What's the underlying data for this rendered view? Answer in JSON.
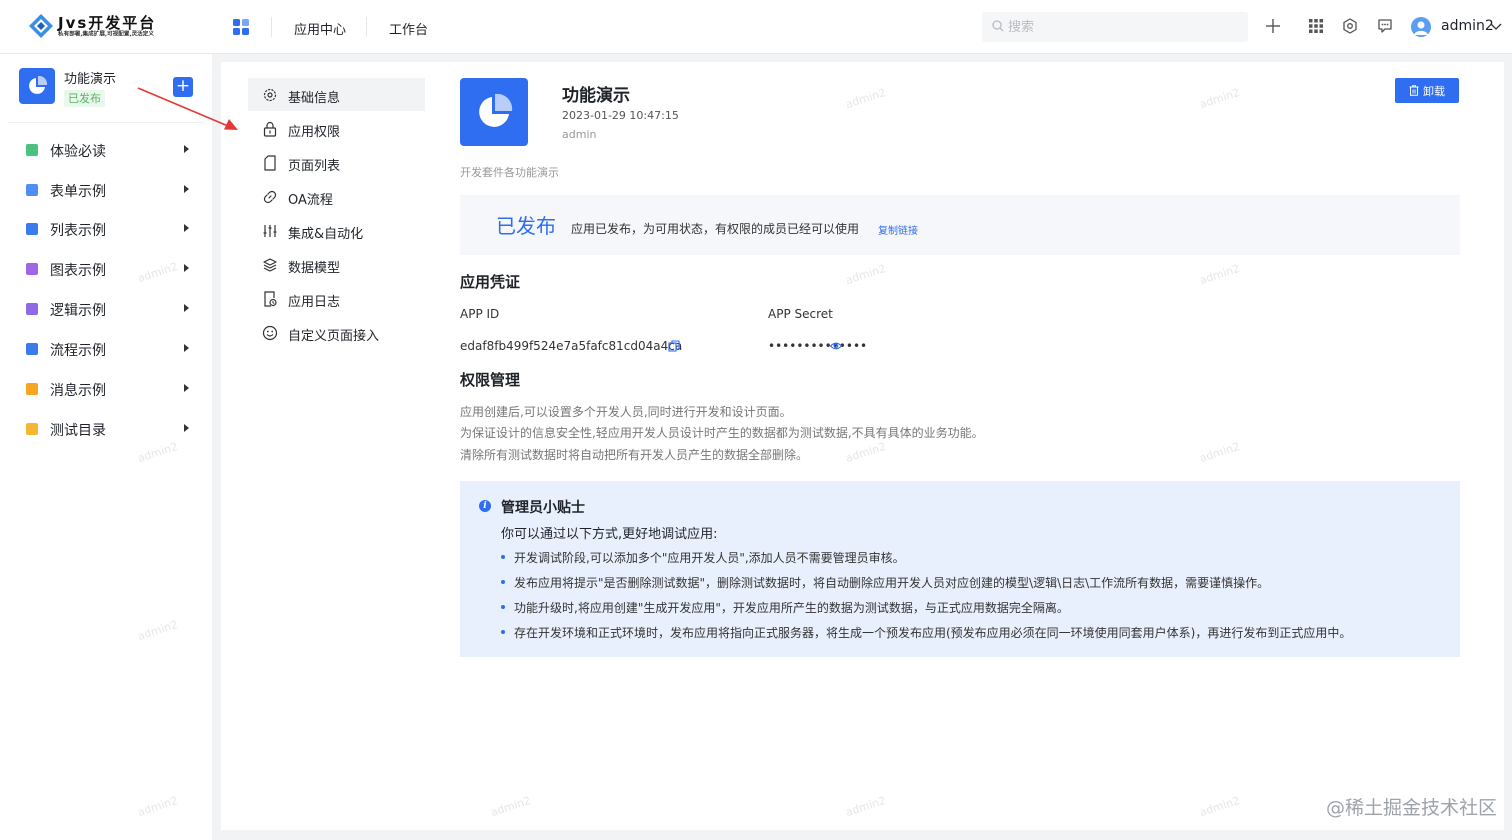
{
  "header": {
    "logo_title": "Jvs开发平台",
    "logo_subtitle": "私有部署,集成扩展,可视配置,灵活定义",
    "nav": [
      "应用中心",
      "工作台"
    ],
    "search_placeholder": "搜索",
    "user_name": "admin2"
  },
  "sidebar": {
    "app_name": "功能演示",
    "app_status": "已发布",
    "add_label": "+",
    "items": [
      {
        "label": "体验必读",
        "color": "#4bc27d"
      },
      {
        "label": "表单示例",
        "color": "#4f8ef5"
      },
      {
        "label": "列表示例",
        "color": "#3a7cf0"
      },
      {
        "label": "图表示例",
        "color": "#9f66e8"
      },
      {
        "label": "逻辑示例",
        "color": "#8e6ae6"
      },
      {
        "label": "流程示例",
        "color": "#3a7cf0"
      },
      {
        "label": "消息示例",
        "color": "#f5a623"
      },
      {
        "label": "测试目录",
        "color": "#f5b731"
      }
    ]
  },
  "subnav": {
    "items": [
      {
        "label": "基础信息",
        "icon": "gear-icon",
        "active": true
      },
      {
        "label": "应用权限",
        "icon": "lock-icon",
        "active": false
      },
      {
        "label": "页面列表",
        "icon": "page-icon",
        "active": false
      },
      {
        "label": "OA流程",
        "icon": "link-icon",
        "active": false
      },
      {
        "label": "集成&自动化",
        "icon": "sliders-icon",
        "active": false
      },
      {
        "label": "数据模型",
        "icon": "layers-icon",
        "active": false
      },
      {
        "label": "应用日志",
        "icon": "log-icon",
        "active": false
      },
      {
        "label": "自定义页面接入",
        "icon": "smile-icon",
        "active": false
      }
    ]
  },
  "app": {
    "title": "功能演示",
    "date": "2023-01-29 10:47:15",
    "author": "admin",
    "description": "开发套件各功能演示",
    "uninstall_label": "卸载"
  },
  "status": {
    "big": "已发布",
    "description": "应用已发布，为可用状态，有权限的成员已经可以使用",
    "copy_link": "复制链接"
  },
  "credentials": {
    "title": "应用凭证",
    "app_id_label": "APP ID",
    "app_id_value": "edaf8fb499f524e7a5fafc81cd04a4ca",
    "app_secret_label": "APP Secret",
    "app_secret_value": "••••••••••••••"
  },
  "permissions": {
    "title": "权限管理",
    "lines": [
      "应用创建后,可以设置多个开发人员,同时进行开发和设计页面。",
      "为保证设计的信息安全性,轻应用开发人员设计时产生的数据都为测试数据,不具有具体的业务功能。",
      "清除所有测试数据时将自动把所有开发人员产生的数据全部删除。"
    ]
  },
  "tips": {
    "title": "管理员小贴士",
    "subtitle": "你可以通过以下方式,更好地调试应用:",
    "items": [
      "开发调试阶段,可以添加多个\"应用开发人员\",添加人员不需要管理员审核。",
      "发布应用将提示\"是否删除测试数据\"，删除测试数据时，将自动删除应用开发人员对应创建的模型\\逻辑\\日志\\工作流所有数据，需要谨慎操作。",
      "功能升级时,将应用创建\"生成开发应用\"，开发应用所产生的数据为测试数据，与正式应用数据完全隔离。",
      "存在开发环境和正式环境时，发布应用将指向正式服务器，将生成一个预发布应用(预发布应用必须在同一环境使用同套用户体系)，再进行发布到正式应用中。"
    ]
  },
  "watermark": "admin2",
  "credit": "@稀土掘金技术社区",
  "colors": {
    "primary": "#2f6df1",
    "success": "#52b75e",
    "tips_bg": "#e9f0fd"
  }
}
